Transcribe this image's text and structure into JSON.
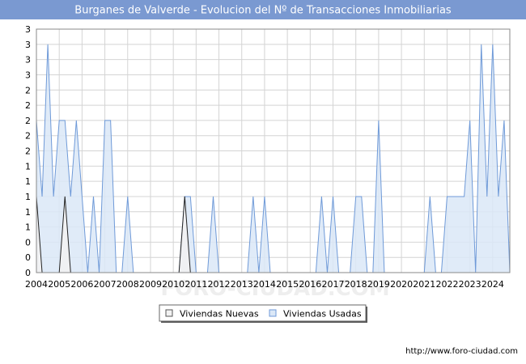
{
  "header": {
    "title": "Burganes de Valverde - Evolucion del Nº de Transacciones Inmobiliarias",
    "background": "#7a99d1"
  },
  "footer": {
    "url": "http://www.foro-ciudad.com"
  },
  "watermark": "FORO-CIUDAD.COM",
  "legend": {
    "placement": "bottom-center",
    "items": [
      {
        "label": "Viviendas Nuevas",
        "fill": "#f2f2f2",
        "stroke": "#555555"
      },
      {
        "label": "Viviendas Usadas",
        "fill": "#dbe8f7",
        "stroke": "#6f9ad8"
      }
    ]
  },
  "chart_data": {
    "type": "area",
    "ylim": [
      0,
      3.2
    ],
    "y_tick_values": [
      0,
      0.2,
      0.4,
      0.6,
      0.8,
      1.0,
      1.2,
      1.4,
      1.6,
      1.8,
      2.0,
      2.2,
      2.4,
      2.6,
      2.8,
      3.0,
      3.2
    ],
    "y_tick_labels": [
      "0",
      "0",
      "0",
      "1",
      "1",
      "1",
      "1",
      "1",
      "2",
      "2",
      "2",
      "2",
      "2",
      "3",
      "3",
      "3",
      "3"
    ],
    "x_range": [
      2004.0,
      2024.75
    ],
    "x_ticks": [
      2004,
      2005,
      2006,
      2007,
      2008,
      2009,
      2010,
      2011,
      2012,
      2013,
      2014,
      2015,
      2016,
      2017,
      2018,
      2019,
      2020,
      2021,
      2022,
      2023,
      2024
    ],
    "grid": true,
    "series": [
      {
        "name": "Viviendas Nuevas",
        "color": "#222222",
        "fill": "#f2f2f2",
        "points": [
          [
            2004.0,
            1
          ],
          [
            2004.25,
            0
          ],
          [
            2004.5,
            0
          ],
          [
            2004.75,
            0
          ],
          [
            2005.0,
            0
          ],
          [
            2005.25,
            1
          ],
          [
            2005.5,
            0
          ],
          [
            2005.75,
            0
          ],
          [
            2006.0,
            0
          ],
          [
            2010.25,
            0
          ],
          [
            2010.5,
            1
          ],
          [
            2010.75,
            0
          ],
          [
            2011.0,
            0
          ],
          [
            2024.75,
            0
          ]
        ]
      },
      {
        "name": "Viviendas Usadas",
        "color": "#6f9ad8",
        "fill": "#dbe8f7",
        "points": [
          [
            2004.0,
            2
          ],
          [
            2004.25,
            1
          ],
          [
            2004.5,
            3
          ],
          [
            2004.75,
            1
          ],
          [
            2005.0,
            2
          ],
          [
            2005.25,
            2
          ],
          [
            2005.5,
            1
          ],
          [
            2005.75,
            2
          ],
          [
            2006.0,
            1
          ],
          [
            2006.25,
            0
          ],
          [
            2006.5,
            1
          ],
          [
            2006.75,
            0
          ],
          [
            2007.0,
            2
          ],
          [
            2007.25,
            2
          ],
          [
            2007.5,
            0
          ],
          [
            2007.75,
            0
          ],
          [
            2008.0,
            1
          ],
          [
            2008.25,
            0
          ],
          [
            2008.5,
            0
          ],
          [
            2008.75,
            0
          ],
          [
            2009.0,
            0
          ],
          [
            2009.25,
            0
          ],
          [
            2009.5,
            0
          ],
          [
            2009.75,
            0
          ],
          [
            2010.0,
            0
          ],
          [
            2010.25,
            0
          ],
          [
            2010.5,
            1
          ],
          [
            2010.75,
            1
          ],
          [
            2011.0,
            0
          ],
          [
            2011.25,
            0
          ],
          [
            2011.5,
            0
          ],
          [
            2011.75,
            1
          ],
          [
            2012.0,
            0
          ],
          [
            2012.25,
            0
          ],
          [
            2012.5,
            0
          ],
          [
            2012.75,
            0
          ],
          [
            2013.0,
            0
          ],
          [
            2013.25,
            0
          ],
          [
            2013.5,
            1
          ],
          [
            2013.75,
            0
          ],
          [
            2014.0,
            1
          ],
          [
            2014.25,
            0
          ],
          [
            2014.5,
            0
          ],
          [
            2014.75,
            0
          ],
          [
            2015.0,
            0
          ],
          [
            2015.25,
            0
          ],
          [
            2015.5,
            0
          ],
          [
            2015.75,
            0
          ],
          [
            2016.0,
            0
          ],
          [
            2016.25,
            0
          ],
          [
            2016.5,
            1
          ],
          [
            2016.75,
            0
          ],
          [
            2017.0,
            1
          ],
          [
            2017.25,
            0
          ],
          [
            2017.5,
            0
          ],
          [
            2017.75,
            0
          ],
          [
            2018.0,
            1
          ],
          [
            2018.25,
            1
          ],
          [
            2018.5,
            0
          ],
          [
            2018.75,
            0
          ],
          [
            2019.0,
            2
          ],
          [
            2019.25,
            0
          ],
          [
            2019.5,
            0
          ],
          [
            2019.75,
            0
          ],
          [
            2020.0,
            0
          ],
          [
            2020.25,
            0
          ],
          [
            2020.5,
            0
          ],
          [
            2020.75,
            0
          ],
          [
            2021.0,
            0
          ],
          [
            2021.25,
            1
          ],
          [
            2021.5,
            0
          ],
          [
            2021.75,
            0
          ],
          [
            2022.0,
            1
          ],
          [
            2022.25,
            1
          ],
          [
            2022.5,
            1
          ],
          [
            2022.75,
            1
          ],
          [
            2023.0,
            2
          ],
          [
            2023.25,
            0
          ],
          [
            2023.5,
            3
          ],
          [
            2023.75,
            1
          ],
          [
            2024.0,
            3
          ],
          [
            2024.25,
            1
          ],
          [
            2024.5,
            2
          ],
          [
            2024.75,
            0
          ]
        ]
      }
    ]
  }
}
